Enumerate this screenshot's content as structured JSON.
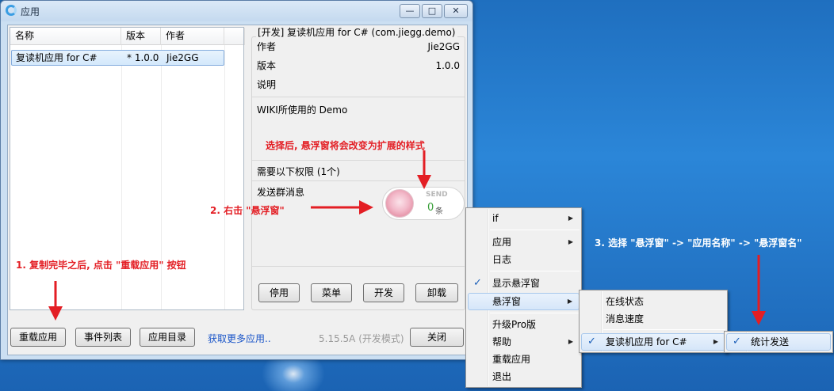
{
  "window": {
    "title": "应用",
    "controls": {
      "minimize": "—",
      "maximize": "□",
      "close": "✕"
    }
  },
  "list": {
    "columns": [
      "名称",
      "版本",
      "作者"
    ],
    "rows": [
      {
        "name": "复读机应用 for C#",
        "version": "* 1.0.0",
        "author": "Jie2GG"
      }
    ]
  },
  "detail": {
    "title": "[开发] 复读机应用 for C# (com.jiegg.demo)",
    "author_label": "作者",
    "author_value": "Jie2GG",
    "version_label": "版本",
    "version_value": "1.0.0",
    "desc_label": "说明",
    "description": "WIKI所使用的 Demo",
    "permissions_header": "需要以下权限 (1个)",
    "permission_item": "发送群消息",
    "buttons": {
      "disable": "停用",
      "menu": "菜单",
      "develop": "开发",
      "uninstall": "卸载"
    }
  },
  "float_widget": {
    "label": "SEND",
    "count": "0",
    "unit": "条"
  },
  "footer": {
    "reload": "重载应用",
    "events": "事件列表",
    "app_dir": "应用目录",
    "more_link": "获取更多应用..",
    "version": "5.15.5A (开发模式)",
    "close": "关闭"
  },
  "context_menu": {
    "items": [
      "if",
      "应用",
      "日志",
      "显示悬浮窗",
      "悬浮窗",
      "升级Pro版",
      "帮助",
      "重载应用",
      "退出"
    ],
    "check": "✓",
    "arrow": "▶"
  },
  "float_submenu": {
    "items": [
      "在线状态",
      "消息速度",
      "复读机应用 for C#"
    ]
  },
  "app_submenu": {
    "items": [
      "统计发送"
    ]
  },
  "annotations": {
    "step1": "1. 复制完毕之后, 点击 \"重载应用\" 按钮",
    "step2": "2. 右击 \"悬浮窗\"",
    "step3": "3. 选择 \"悬浮窗\" -> \"应用名称\" -> \"悬浮窗名\"",
    "note": "选择后, 悬浮窗将会改变为扩展的样式"
  },
  "colors": {
    "annotation": "#e31e24",
    "link": "#1a55c8",
    "count": "#3aa03a",
    "desktop": "#2b86d8"
  }
}
